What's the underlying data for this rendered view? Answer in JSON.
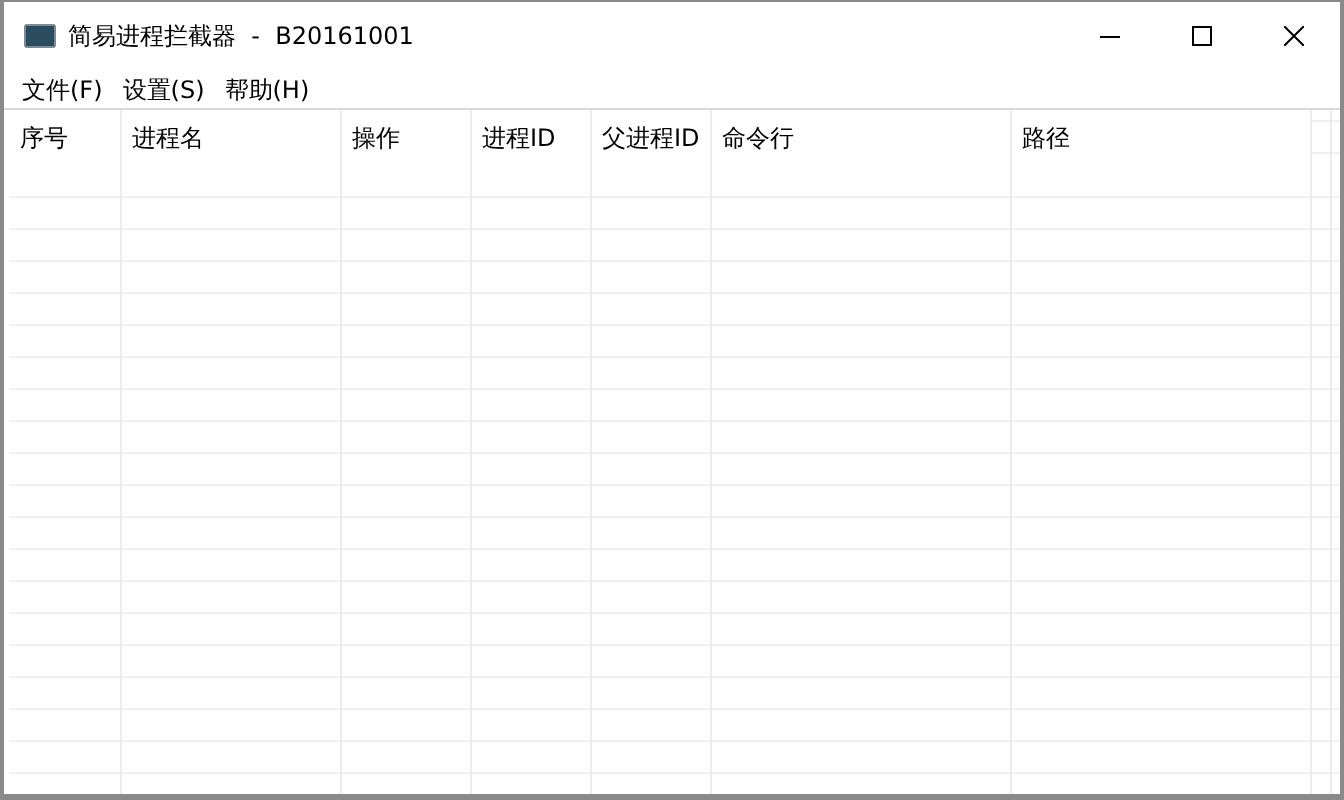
{
  "window": {
    "title": "简易进程拦截器  -  B20161001"
  },
  "menu": [
    "文件(F)",
    "设置(S)",
    "帮助(H)"
  ],
  "table": {
    "columns": [
      "序号",
      "进程名",
      "操作",
      "进程ID",
      "父进程ID",
      "命令行",
      "路径"
    ]
  }
}
